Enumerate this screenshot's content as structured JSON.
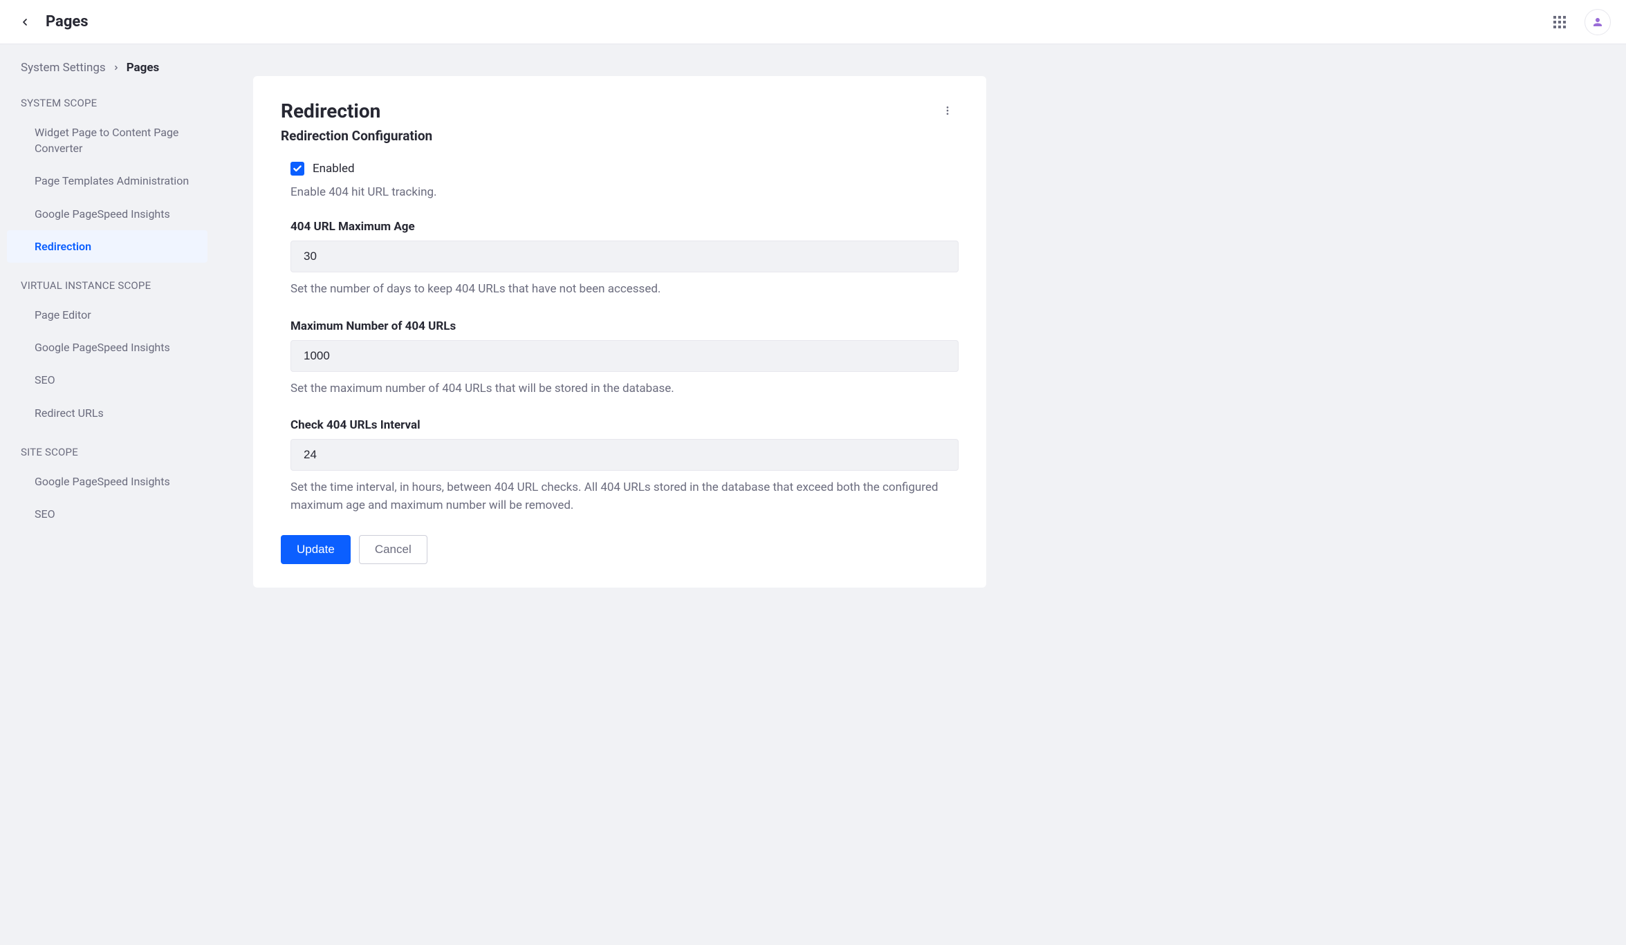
{
  "topbar": {
    "title": "Pages"
  },
  "breadcrumb": {
    "parent": "System Settings",
    "current": "Pages"
  },
  "sidebar": {
    "groups": [
      {
        "label": "SYSTEM SCOPE",
        "items": [
          {
            "label": "Widget Page to Content Page Converter",
            "active": false
          },
          {
            "label": "Page Templates Administration",
            "active": false
          },
          {
            "label": "Google PageSpeed Insights",
            "active": false
          },
          {
            "label": "Redirection",
            "active": true
          }
        ]
      },
      {
        "label": "VIRTUAL INSTANCE SCOPE",
        "items": [
          {
            "label": "Page Editor",
            "active": false
          },
          {
            "label": "Google PageSpeed Insights",
            "active": false
          },
          {
            "label": "SEO",
            "active": false
          },
          {
            "label": "Redirect URLs",
            "active": false
          }
        ]
      },
      {
        "label": "SITE SCOPE",
        "items": [
          {
            "label": "Google PageSpeed Insights",
            "active": false
          },
          {
            "label": "SEO",
            "active": false
          }
        ]
      }
    ]
  },
  "card": {
    "title": "Redirection",
    "subtitle": "Redirection Configuration"
  },
  "form": {
    "enabled_label": "Enabled",
    "enabled_help": "Enable 404 hit URL tracking.",
    "max_age": {
      "label": "404 URL Maximum Age",
      "value": "30",
      "help": "Set the number of days to keep 404 URLs that have not been accessed."
    },
    "max_urls": {
      "label": "Maximum Number of 404 URLs",
      "value": "1000",
      "help": "Set the maximum number of 404 URLs that will be stored in the database."
    },
    "interval": {
      "label": "Check 404 URLs Interval",
      "value": "24",
      "help": "Set the time interval, in hours, between 404 URL checks. All 404 URLs stored in the database that exceed both the configured maximum age and maximum number will be removed."
    },
    "buttons": {
      "update": "Update",
      "cancel": "Cancel"
    }
  }
}
